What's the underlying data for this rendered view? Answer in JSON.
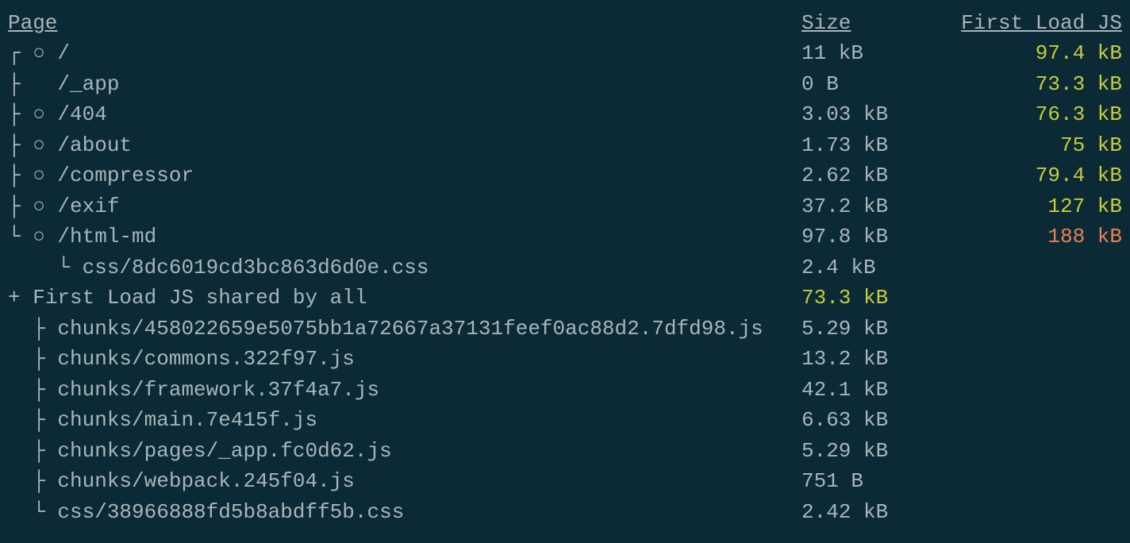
{
  "headers": {
    "page": "Page",
    "size": "Size",
    "firstLoad": "First Load JS"
  },
  "routes": [
    {
      "tree": "┌ ○ ",
      "path": "/",
      "size": "11 kB",
      "firstLoad": "97.4 kB",
      "color": "yellow"
    },
    {
      "tree": "├   ",
      "path": "/_app",
      "size": "0 B",
      "firstLoad": "73.3 kB",
      "color": "yellow"
    },
    {
      "tree": "├ ○ ",
      "path": "/404",
      "size": "3.03 kB",
      "firstLoad": "76.3 kB",
      "color": "yellow"
    },
    {
      "tree": "├ ○ ",
      "path": "/about",
      "size": "1.73 kB",
      "firstLoad": "75 kB",
      "color": "yellow"
    },
    {
      "tree": "├ ○ ",
      "path": "/compressor",
      "size": "2.62 kB",
      "firstLoad": "79.4 kB",
      "color": "yellow"
    },
    {
      "tree": "├ ○ ",
      "path": "/exif",
      "size": "37.2 kB",
      "firstLoad": "127 kB",
      "color": "yellow"
    },
    {
      "tree": "└ ○ ",
      "path": "/html-md",
      "size": "97.8 kB",
      "firstLoad": "188 kB",
      "color": "orange"
    },
    {
      "tree": "    └ ",
      "path": "css/8dc6019cd3bc863d6d0e.css",
      "size": "2.4 kB",
      "firstLoad": "",
      "color": ""
    }
  ],
  "shared": {
    "prefix": "+ ",
    "label": "First Load JS shared by all",
    "size": "73.3 kB",
    "color": "yellow"
  },
  "chunks": [
    {
      "tree": "  ├ ",
      "path": "chunks/458022659e5075bb1a72667a37131feef0ac88d2.7dfd98.js",
      "size": "5.29 kB"
    },
    {
      "tree": "  ├ ",
      "path": "chunks/commons.322f97.js",
      "size": "13.2 kB"
    },
    {
      "tree": "  ├ ",
      "path": "chunks/framework.37f4a7.js",
      "size": "42.1 kB"
    },
    {
      "tree": "  ├ ",
      "path": "chunks/main.7e415f.js",
      "size": "6.63 kB"
    },
    {
      "tree": "  ├ ",
      "path": "chunks/pages/_app.fc0d62.js",
      "size": "5.29 kB"
    },
    {
      "tree": "  ├ ",
      "path": "chunks/webpack.245f04.js",
      "size": "751 B"
    },
    {
      "tree": "  └ ",
      "path": "css/38966888fd5b8abdff5b.css",
      "size": "2.42 kB"
    }
  ]
}
